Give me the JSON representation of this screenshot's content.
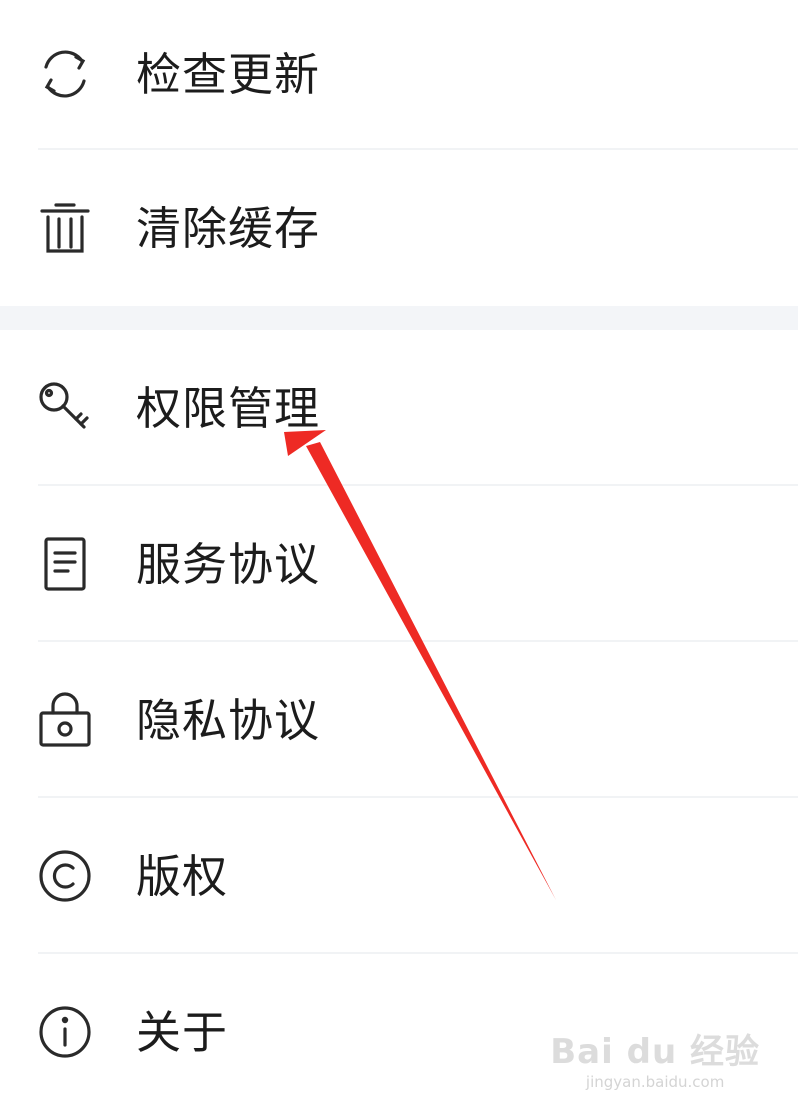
{
  "menu": {
    "items": [
      {
        "label": "检查更新",
        "icon": "refresh-icon"
      },
      {
        "label": "清除缓存",
        "icon": "trash-icon"
      },
      {
        "label": "权限管理",
        "icon": "key-icon"
      },
      {
        "label": "服务协议",
        "icon": "document-icon"
      },
      {
        "label": "隐私协议",
        "icon": "lock-icon"
      },
      {
        "label": "版权",
        "icon": "copyright-icon"
      },
      {
        "label": "关于",
        "icon": "info-icon"
      }
    ]
  },
  "annotation": {
    "arrow_color": "#ee2a24",
    "target": "权限管理"
  },
  "watermark": {
    "main": "Bai du 经验",
    "sub": "jingyan.baidu.com"
  },
  "colors": {
    "text": "#1c1c1c",
    "icon": "#2a2a2a",
    "divider": "#f1f3f5",
    "section_gap": "#f3f5f8"
  }
}
